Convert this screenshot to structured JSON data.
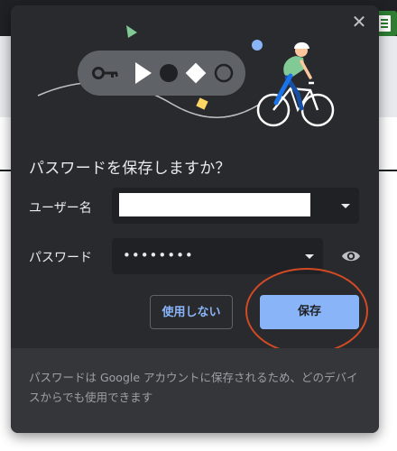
{
  "dialog": {
    "title": "パスワードを保存しますか？",
    "close_icon": "close-icon",
    "username": {
      "label": "ユーザー名",
      "value": "",
      "dropdown_icon": "chevron-down-icon"
    },
    "password": {
      "label": "パスワード",
      "masked_value": "••••••••",
      "dropdown_icon": "chevron-down-icon",
      "reveal_icon": "eye-icon"
    },
    "buttons": {
      "dont_use": "使用しない",
      "save": "保存"
    },
    "footer": {
      "text": "パスワードは Google アカウントに保存されるため、どのデバイスからでも使用できます"
    }
  },
  "colors": {
    "dialog_background": "#292a2d",
    "footer_background": "#35363a",
    "accent": "#8ab4f8",
    "annotation_circle": "#d14a24"
  }
}
